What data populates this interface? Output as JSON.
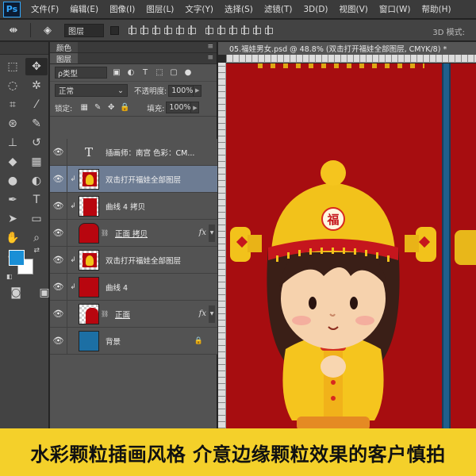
{
  "app": {
    "logo": "Ps"
  },
  "menubar": {
    "items": [
      "文件(F)",
      "编辑(E)",
      "图像(I)",
      "图层(L)",
      "文字(Y)",
      "选择(S)",
      "滤镜(T)",
      "3D(D)",
      "视图(V)",
      "窗口(W)",
      "帮助(H)"
    ]
  },
  "options": {
    "layer_select": "图层",
    "mode_3d": "3D 模式:"
  },
  "toolbar": {
    "foreground_color": "#1a8fd6",
    "background_color": "#ffffff"
  },
  "panels": {
    "collapsed_tab": "颜色",
    "active_tab": "图层",
    "filter_type": "ρ类型",
    "blend_mode": "正常",
    "opacity_label": "不透明度:",
    "opacity_value": "100%",
    "lock_label": "锁定:",
    "fill_label": "填充:",
    "fill_value": "100%"
  },
  "layers": [
    {
      "name": "插画师：南宫 色彩：CM...",
      "thumb": "type",
      "clip": false,
      "fx": false,
      "lock": false,
      "selected": false,
      "underline": false
    },
    {
      "name": "双击打开福娃全部图层",
      "thumb": "smart",
      "clip": true,
      "fx": false,
      "lock": false,
      "selected": true,
      "underline": false
    },
    {
      "name": "曲线 4 拷贝",
      "thumb": "red",
      "clip": true,
      "fx": false,
      "lock": false,
      "selected": false,
      "underline": false
    },
    {
      "name": "正面 拷贝",
      "thumb": "red-shape",
      "clip": false,
      "fx": true,
      "lock": false,
      "selected": false,
      "underline": true
    },
    {
      "name": "双击打开福娃全部图层",
      "thumb": "smart",
      "clip": true,
      "fx": false,
      "lock": false,
      "selected": false,
      "underline": false
    },
    {
      "name": "曲线 4",
      "thumb": "red",
      "clip": true,
      "fx": false,
      "lock": false,
      "selected": false,
      "underline": false
    },
    {
      "name": "正面",
      "thumb": "checker-shape",
      "clip": false,
      "fx": true,
      "lock": false,
      "selected": false,
      "underline": true
    },
    {
      "name": "背景",
      "thumb": "blue",
      "clip": false,
      "fx": false,
      "lock": true,
      "selected": false,
      "underline": false
    }
  ],
  "document": {
    "tab_label": "05.福娃男女.psd @ 48.8% (双击打开福娃全部图层, CMYK/8) *",
    "hat_character": "福"
  },
  "banner": {
    "text": "水彩颗粒插画风格  介意边缘颗粒效果的客户慎拍"
  }
}
